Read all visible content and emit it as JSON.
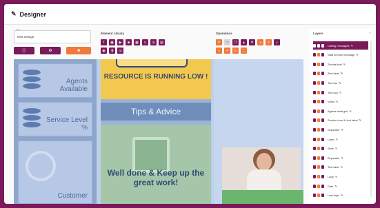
{
  "window": {
    "title": "Designer"
  },
  "name_field": {
    "caption": "Title",
    "value": "New Design"
  },
  "actions": {
    "info_label": "ⓘ",
    "settings_label": "⚙",
    "delete_label": "■"
  },
  "sections": {
    "element_library": "Element Library",
    "operations": "Operations",
    "layers": "Layers"
  },
  "canvas": {
    "agents_label": "Agents Available",
    "service_label": "Service Level %",
    "customer_label": "Customer",
    "warning": "RESOURCE IS RUNNING LOW !",
    "tips": "Tips & Advice",
    "well_done": "Well done & Keep up the great work!"
  },
  "layers": [
    {
      "label": "Calling messages",
      "active": true
    },
    {
      "label": "Staff service message",
      "active": false
    },
    {
      "label": "Tutorial text",
      "active": false
    },
    {
      "label": "Text label",
      "active": false
    },
    {
      "label": "Text bar",
      "active": false
    },
    {
      "label": "Text box",
      "active": false
    },
    {
      "label": "Video",
      "active": false
    },
    {
      "label": "Agents avail grid",
      "active": false
    },
    {
      "label": "Service level & text label",
      "active": false
    },
    {
      "label": "Separator",
      "active": false
    },
    {
      "label": "Label",
      "active": false
    },
    {
      "label": "Slide",
      "active": false
    },
    {
      "label": "Separator",
      "active": false
    },
    {
      "label": "Text label",
      "active": false
    },
    {
      "label": "Logo",
      "active": false
    },
    {
      "label": "Date",
      "active": false
    },
    {
      "label": "Last layer",
      "active": false
    }
  ],
  "colors": {
    "brand": "#7a1a59",
    "accent": "#ef7a3c"
  }
}
